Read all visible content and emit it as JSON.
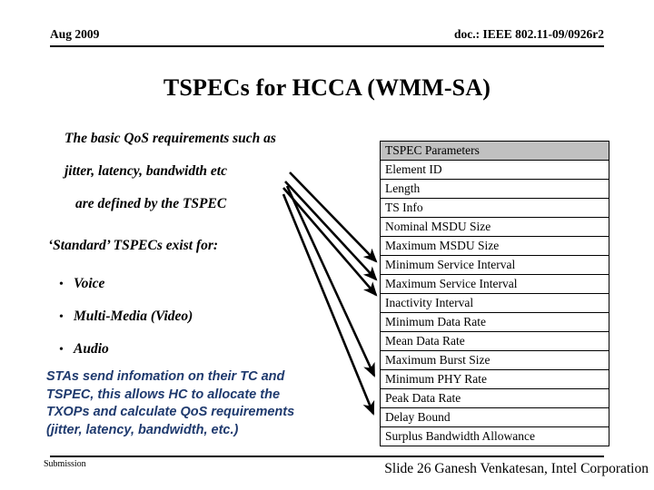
{
  "header": {
    "date": "Aug 2009",
    "doc": "doc.: IEEE 802.11-09/0926r2"
  },
  "title": "TSPECs for HCCA (WMM-SA)",
  "body": {
    "intro_lines": [
      "The basic QoS requirements such as",
      "jitter, latency, bandwidth etc",
      "are defined by the TSPEC"
    ],
    "standard_lead": "‘Standard’ TSPECs exist for:",
    "bullet_char": "•",
    "bullets": [
      "Voice",
      "Multi-Media (Video)",
      "Audio"
    ],
    "blue_paragraph_lines": [
      "STAs send infomation on their TC and",
      "TSPEC, this allows HC to allocate the",
      "TXOPs and calculate QoS requirements",
      "(jitter, latency, bandwidth, etc.)"
    ],
    "blue_color": "#1f3a6e"
  },
  "table": {
    "header": "TSPEC Parameters",
    "header_bg": "#c0c0c0",
    "rows": [
      "Element ID",
      "Length",
      "TS Info",
      "Nominal MSDU Size",
      "Maximum MSDU Size",
      "Minimum Service Interval",
      "Maximum Service Interval",
      "Inactivity Interval",
      "Minimum Data Rate",
      "Mean Data Rate",
      "Maximum Burst Size",
      "Minimum PHY Rate",
      "Peak Data Rate",
      "Delay Bound",
      "Surplus Bandwidth Allowance"
    ]
  },
  "arrows": {
    "count": 5,
    "color": "#000000",
    "description": "five arrows fanning from the body text toward rows of the TSPEC Parameters table"
  },
  "footer": {
    "left": "Submission",
    "right": "Slide 26 Ganesh Venkatesan, Intel Corporation"
  }
}
